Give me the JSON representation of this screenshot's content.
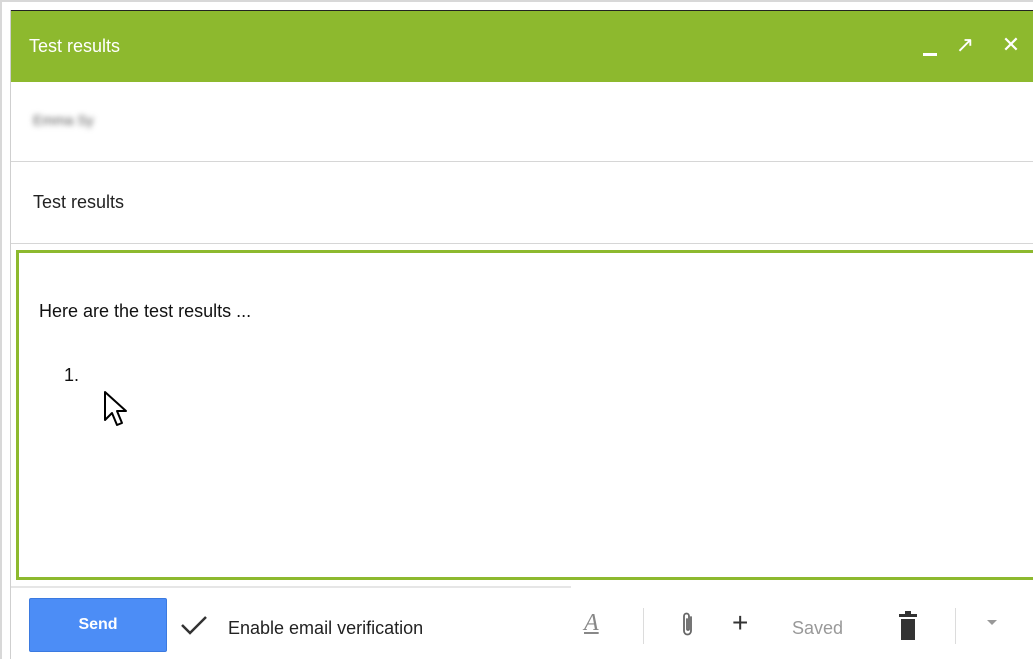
{
  "window": {
    "title": "Test results",
    "minimize_icon": "minimize-icon",
    "popout_icon": "popout-arrow-icon",
    "popout_glyph": "↗",
    "close_icon": "close-icon",
    "close_glyph": "✕"
  },
  "compose": {
    "to_recipient": "Emma Sy",
    "subject": "Test results",
    "body_text": "Here are  the test results ...",
    "list_marker": "1."
  },
  "toolbar": {
    "send_label": "Send",
    "verification_label": "Enable email verification",
    "format_glyph": "A",
    "plus_glyph": "+",
    "saved_label": "Saved"
  },
  "colors": {
    "title_bar": "#8db92e",
    "send_button": "#4c8df6",
    "focus_border": "#8db92e"
  }
}
